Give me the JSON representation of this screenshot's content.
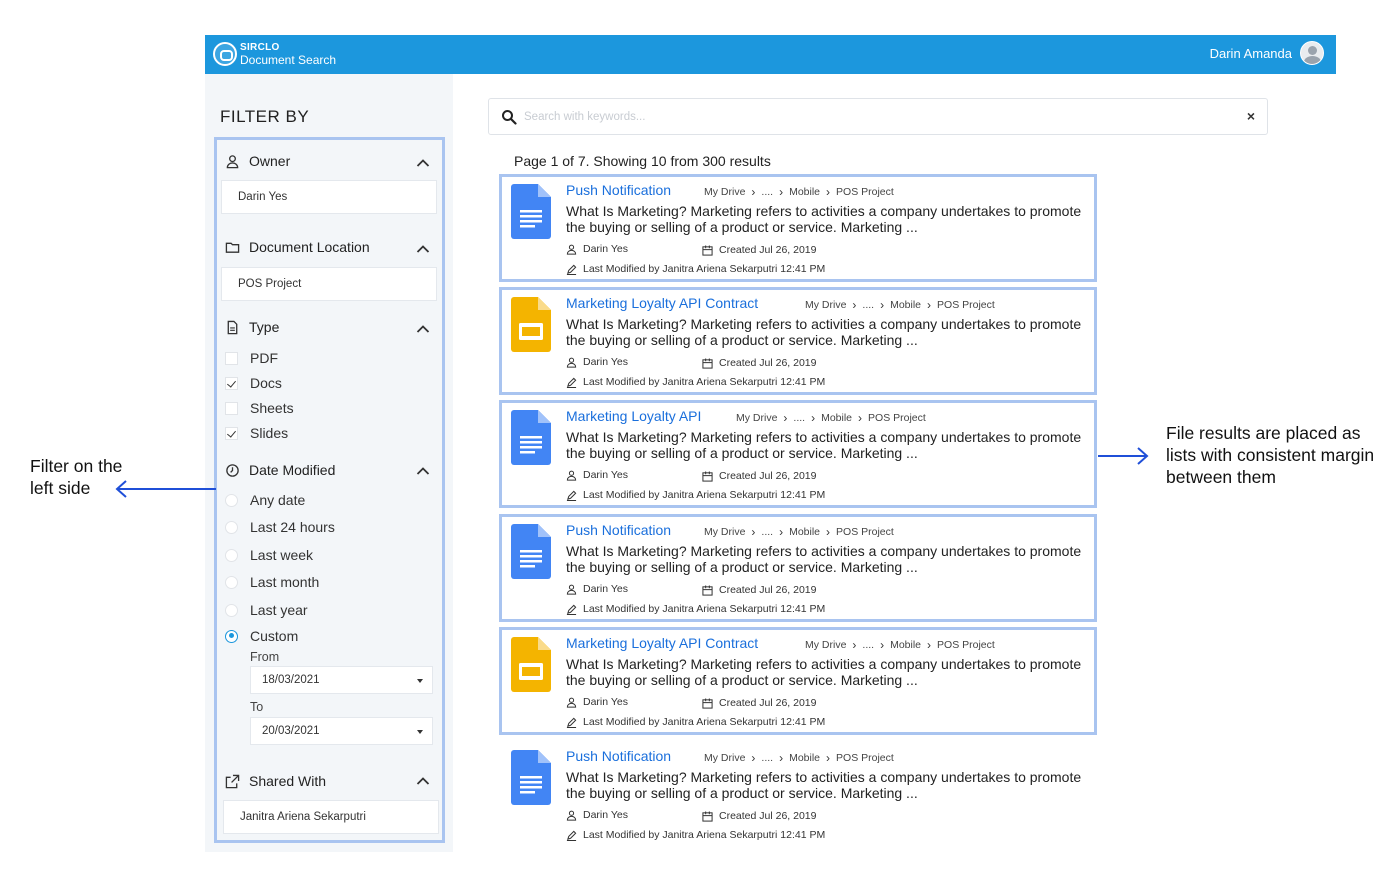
{
  "app": {
    "brand_top": "SIRCLO",
    "brand_bottom": "Document Search",
    "user_name": "Darin Amanda"
  },
  "sidebar": {
    "title": "FILTER BY",
    "owner": {
      "label": "Owner",
      "value": "Darin Yes"
    },
    "location": {
      "label": "Document Location",
      "value": "POS Project"
    },
    "type": {
      "label": "Type",
      "options": [
        {
          "label": "PDF",
          "checked": false
        },
        {
          "label": "Docs",
          "checked": true
        },
        {
          "label": "Sheets",
          "checked": false
        },
        {
          "label": "Slides",
          "checked": true
        }
      ]
    },
    "date_modified": {
      "label": "Date Modified",
      "options": [
        "Any date",
        "Last 24 hours",
        "Last week",
        "Last month",
        "Last year",
        "Custom"
      ],
      "selected": "Custom",
      "from_label": "From",
      "from_value": "18/03/2021",
      "to_label": "To",
      "to_value": "20/03/2021"
    },
    "shared_with": {
      "label": "Shared With",
      "value": "Janitra Ariena Sekarputri"
    }
  },
  "search": {
    "placeholder": "Search with keywords...",
    "value": "",
    "clear": "×"
  },
  "results_info": "Page 1 of 7. Showing 10 from 300 results",
  "results": [
    {
      "type": "doc",
      "title": "Push Notification",
      "crumbs": [
        "My Drive",
        "....",
        "Mobile",
        "POS Project"
      ],
      "desc": "What Is Marketing? Marketing refers to activities a company undertakes to promote the buying or selling of a product or service. Marketing ...",
      "owner": "Darin Yes",
      "created": "Created Jul 26, 2019",
      "modified": "Last Modified by Janitra Ariena Sekarputri 12:41 PM",
      "highlighted": true
    },
    {
      "type": "slides",
      "title": "Marketing Loyalty API Contract",
      "crumbs": [
        "My Drive",
        "....",
        "Mobile",
        "POS Project"
      ],
      "desc": "What Is Marketing? Marketing refers to activities a company undertakes to promote the buying or selling of a product or service. Marketing ...",
      "owner": "Darin Yes",
      "created": "Created Jul 26, 2019",
      "modified": "Last Modified by Janitra Ariena Sekarputri 12:41 PM",
      "highlighted": true
    },
    {
      "type": "doc",
      "title": "Marketing Loyalty API",
      "crumbs": [
        "My Drive",
        "....",
        "Mobile",
        "POS Project"
      ],
      "desc": "What Is Marketing? Marketing refers to activities a company undertakes to promote the buying or selling of a product or service. Marketing ...",
      "owner": "Darin Yes",
      "created": "Created Jul 26, 2019",
      "modified": "Last Modified by Janitra Ariena Sekarputri 12:41 PM",
      "highlighted": true
    },
    {
      "type": "doc",
      "title": "Push Notification",
      "crumbs": [
        "My Drive",
        "....",
        "Mobile",
        "POS Project"
      ],
      "desc": "What Is Marketing? Marketing refers to activities a company undertakes to promote the buying or selling of a product or service. Marketing ...",
      "owner": "Darin Yes",
      "created": "Created Jul 26, 2019",
      "modified": "Last Modified by Janitra Ariena Sekarputri 12:41 PM",
      "highlighted": true
    },
    {
      "type": "slides",
      "title": "Marketing Loyalty API Contract",
      "crumbs": [
        "My Drive",
        "....",
        "Mobile",
        "POS Project"
      ],
      "desc": "What Is Marketing? Marketing refers to activities a company undertakes to promote the buying or selling of a product or service. Marketing ...",
      "owner": "Darin Yes",
      "created": "Created Jul 26, 2019",
      "modified": "Last Modified by Janitra Ariena Sekarputri 12:41 PM",
      "highlighted": true
    },
    {
      "type": "doc",
      "title": "Push Notification",
      "crumbs": [
        "My Drive",
        "....",
        "Mobile",
        "POS Project"
      ],
      "desc": "What Is Marketing? Marketing refers to activities a company undertakes to promote the buying or selling of a product or service. Marketing ...",
      "owner": "Darin Yes",
      "created": "Created Jul 26, 2019",
      "modified": "Last Modified by Janitra Ariena Sekarputri 12:41 PM",
      "highlighted": false
    }
  ],
  "annotations": {
    "left": "Filter on the left side",
    "right": "File results are placed as lists with consistent margin between them"
  },
  "colors": {
    "header": "#1c97dd",
    "highlight": "#a9c4f0",
    "link": "#1a6fdc",
    "doc_icon": "#4285f4",
    "slides_icon": "#f4b400",
    "annotation_arrow": "#1f4fd8"
  }
}
